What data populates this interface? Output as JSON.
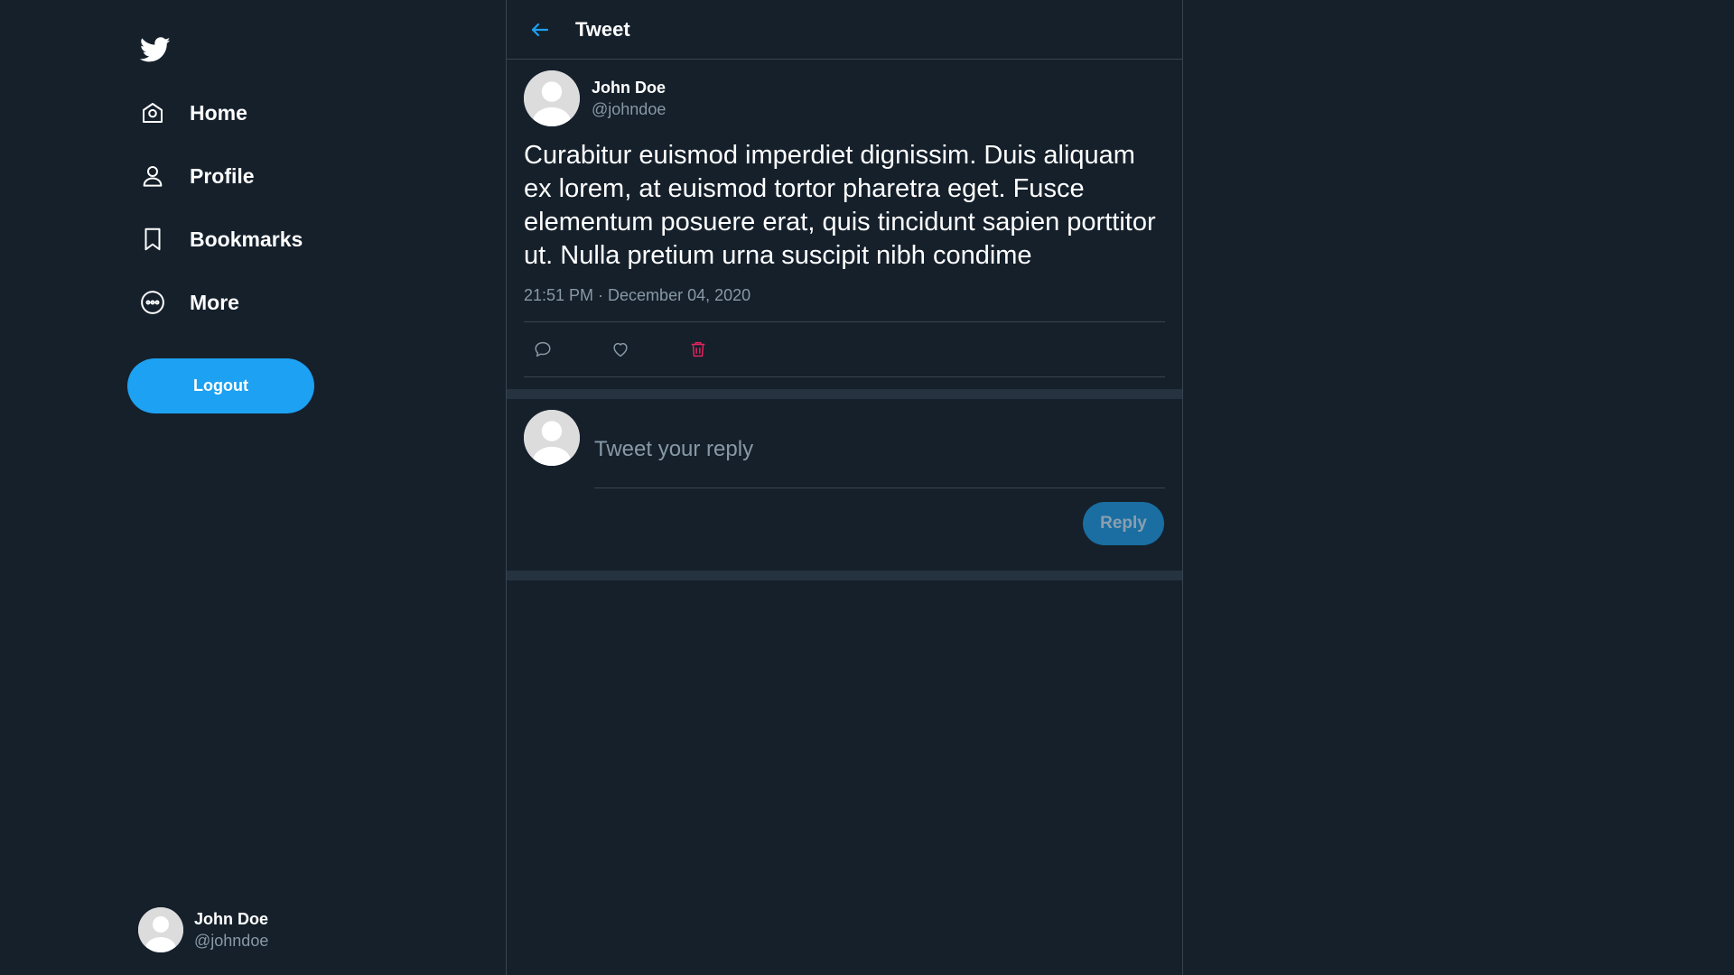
{
  "sidebar": {
    "logo_icon": "twitter-bird-icon",
    "nav": [
      {
        "label": "Home",
        "icon": "home-icon"
      },
      {
        "label": "Profile",
        "icon": "user-icon"
      },
      {
        "label": "Bookmarks",
        "icon": "bookmark-icon"
      },
      {
        "label": "More",
        "icon": "more-circle-icon"
      }
    ],
    "logout_label": "Logout",
    "user": {
      "name": "John Doe",
      "handle": "@johndoe"
    }
  },
  "header": {
    "title": "Tweet",
    "back_icon": "arrow-left-icon"
  },
  "tweet": {
    "author": {
      "name": "John Doe",
      "handle": "@johndoe"
    },
    "text": "Curabitur euismod imperdiet dignissim. Duis aliquam ex lorem, at euismod tortor pharetra eget. Fusce elementum posuere erat, quis tincidunt sapien porttitor ut. Nulla pretium urna suscipit nibh condime",
    "timestamp": "21:51 PM · December 04, 2020",
    "actions": [
      "comment-icon",
      "heart-icon",
      "trash-icon"
    ]
  },
  "reply": {
    "placeholder": "Tweet your reply",
    "button_label": "Reply"
  },
  "colors": {
    "background": "#15202b",
    "accent": "#1da1f2",
    "muted_text": "#8899a6",
    "border": "#38444d",
    "delete": "#e0245e"
  }
}
